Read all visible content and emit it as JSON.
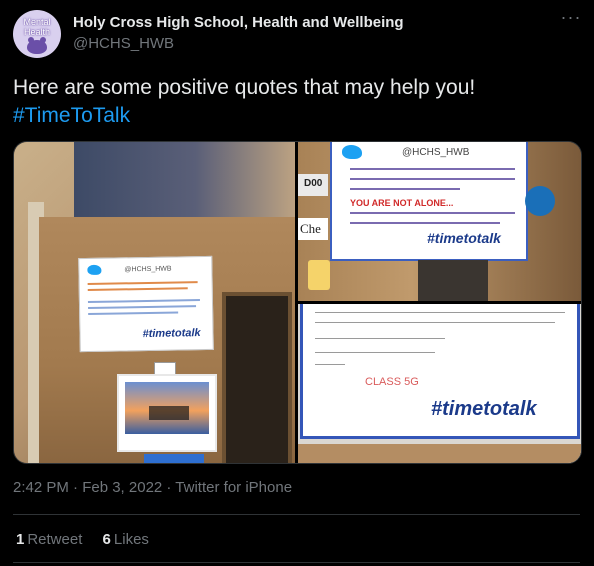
{
  "author": {
    "avatar_line1": "Mental",
    "avatar_line2": "Health",
    "display_name": "Holy Cross High School, Health and Wellbeing",
    "handle": "@HCHS_HWB"
  },
  "tweet": {
    "text": "Here are some positive quotes that may help you!",
    "hashtag": "#TimeToTalk"
  },
  "media": {
    "photo1": {
      "poster_handle": "@HCHS_HWB",
      "poster_tag": "#timetotalk"
    },
    "photo2": {
      "door_label": "D00",
      "che_label": "Che",
      "poster_handle": "@HCHS_HWB",
      "red_text": "YOU ARE NOT ALONE...",
      "poster_tag": "#timetotalk"
    },
    "photo3": {
      "class_text": "CLASS 5G",
      "poster_tag": "#timetotalk"
    }
  },
  "meta": {
    "timestamp": "2:42 PM · Feb 3, 2022 · Twitter for iPhone"
  },
  "stats": {
    "retweets_count": "1",
    "retweets_label": "Retweet",
    "likes_count": "6",
    "likes_label": "Likes"
  },
  "colors": {
    "background": "#000000",
    "text_primary": "#e7e9ea",
    "text_secondary": "#71767b",
    "hashtag": "#1d9bf0"
  }
}
